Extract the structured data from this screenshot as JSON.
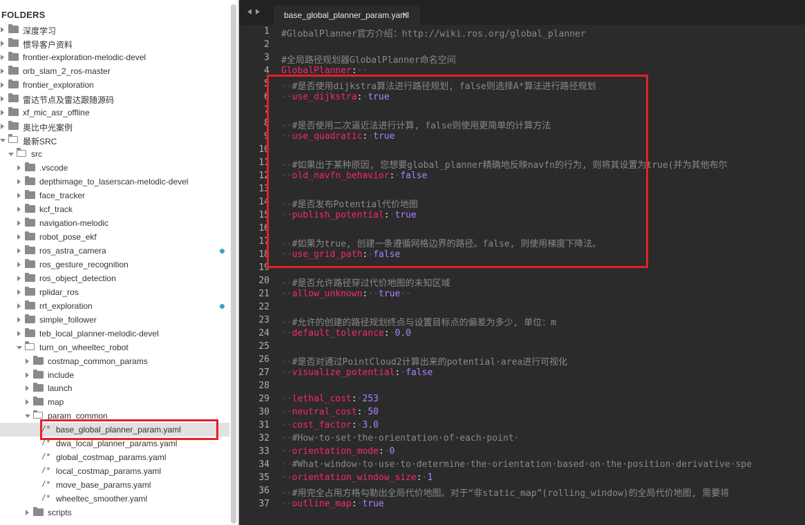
{
  "sidebar": {
    "title": "FOLDERS",
    "items": [
      {
        "label": "深度学习",
        "type": "folder",
        "depth": 0,
        "open": false
      },
      {
        "label": "惯导客户资料",
        "type": "folder",
        "depth": 0,
        "open": false
      },
      {
        "label": "frontier-exploration-melodic-devel",
        "type": "folder",
        "depth": 0,
        "open": false
      },
      {
        "label": "orb_slam_2_ros-master",
        "type": "folder",
        "depth": 0,
        "open": false
      },
      {
        "label": "frontier_exploration",
        "type": "folder",
        "depth": 0,
        "open": false
      },
      {
        "label": "雷达节点及雷达跟随源码",
        "type": "folder",
        "depth": 0,
        "open": false
      },
      {
        "label": "xf_mic_asr_offline",
        "type": "folder",
        "depth": 0,
        "open": false
      },
      {
        "label": "奥比中光案例",
        "type": "folder",
        "depth": 0,
        "open": false
      },
      {
        "label": "最新SRC",
        "type": "folder",
        "depth": 0,
        "open": true
      },
      {
        "label": "src",
        "type": "folder",
        "depth": 1,
        "open": true
      },
      {
        "label": ".vscode",
        "type": "folder",
        "depth": 2,
        "open": false
      },
      {
        "label": "depthimage_to_laserscan-melodic-devel",
        "type": "folder",
        "depth": 2,
        "open": false
      },
      {
        "label": "face_tracker",
        "type": "folder",
        "depth": 2,
        "open": false
      },
      {
        "label": "kcf_track",
        "type": "folder",
        "depth": 2,
        "open": false
      },
      {
        "label": "navigation-melodic",
        "type": "folder",
        "depth": 2,
        "open": false
      },
      {
        "label": "robot_pose_ekf",
        "type": "folder",
        "depth": 2,
        "open": false
      },
      {
        "label": "ros_astra_camera",
        "type": "folder",
        "depth": 2,
        "open": false,
        "dot": true
      },
      {
        "label": "ros_gesture_recognition",
        "type": "folder",
        "depth": 2,
        "open": false
      },
      {
        "label": "ros_object_detection",
        "type": "folder",
        "depth": 2,
        "open": false
      },
      {
        "label": "rplidar_ros",
        "type": "folder",
        "depth": 2,
        "open": false
      },
      {
        "label": "rrt_exploration",
        "type": "folder",
        "depth": 2,
        "open": false,
        "dot": true
      },
      {
        "label": "simple_follower",
        "type": "folder",
        "depth": 2,
        "open": false
      },
      {
        "label": "teb_local_planner-melodic-devel",
        "type": "folder",
        "depth": 2,
        "open": false
      },
      {
        "label": "turn_on_wheeltec_robot",
        "type": "folder",
        "depth": 2,
        "open": true
      },
      {
        "label": "costmap_common_params",
        "type": "folder",
        "depth": 3,
        "open": false
      },
      {
        "label": "include",
        "type": "folder",
        "depth": 3,
        "open": false
      },
      {
        "label": "launch",
        "type": "folder",
        "depth": 3,
        "open": false
      },
      {
        "label": "map",
        "type": "folder",
        "depth": 3,
        "open": false
      },
      {
        "label": "param_common",
        "type": "folder",
        "depth": 3,
        "open": true
      },
      {
        "label": "base_global_planner_param.yaml",
        "type": "file",
        "depth": 4,
        "selected": true
      },
      {
        "label": "dwa_local_planner_params.yaml",
        "type": "file",
        "depth": 4
      },
      {
        "label": "global_costmap_params.yaml",
        "type": "file",
        "depth": 4
      },
      {
        "label": "local_costmap_params.yaml",
        "type": "file",
        "depth": 4
      },
      {
        "label": "move_base_params.yaml",
        "type": "file",
        "depth": 4
      },
      {
        "label": "wheeltec_smoother.yaml",
        "type": "file",
        "depth": 4
      },
      {
        "label": "scripts",
        "type": "folder",
        "depth": 3,
        "open": false
      }
    ],
    "file_glyph": "/*"
  },
  "editor": {
    "tab_label": "base_global_planner_param.yaml",
    "tab_close": "×",
    "whitespace_dot": "·",
    "lines": [
      {
        "n": "1",
        "parts": [
          [
            "c-comment",
            "#GlobalPlanner官方介绍：http://wiki.ros.org/global_planner"
          ]
        ]
      },
      {
        "n": "2",
        "parts": []
      },
      {
        "n": "3",
        "parts": [
          [
            "c-comment",
            "#全局路径规划器GlobalPlanner命名空间"
          ]
        ]
      },
      {
        "n": "4",
        "parts": [
          [
            "c-root",
            "GlobalPlanner"
          ],
          [
            "c-punct",
            ":"
          ],
          [
            "c-ws",
            "··"
          ]
        ]
      },
      {
        "n": "5",
        "parts": [
          [
            "c-ws",
            "··"
          ],
          [
            "c-comment",
            "#是否使用dijkstra算法进行路径规划, false则选择A*算法进行路径规划"
          ]
        ]
      },
      {
        "n": "6",
        "parts": [
          [
            "c-ws",
            "··"
          ],
          [
            "c-key",
            "use_dijkstra"
          ],
          [
            "c-punct",
            ":"
          ],
          [
            "c-ws",
            "·"
          ],
          [
            "c-bool",
            "true"
          ]
        ]
      },
      {
        "n": "7",
        "parts": []
      },
      {
        "n": "8",
        "parts": [
          [
            "c-ws",
            "··"
          ],
          [
            "c-comment",
            "#是否使用二次逼近法进行计算, false则使用更简单的计算方法"
          ]
        ]
      },
      {
        "n": "9",
        "parts": [
          [
            "c-ws",
            "··"
          ],
          [
            "c-key",
            "use_quadratic"
          ],
          [
            "c-punct",
            ":"
          ],
          [
            "c-ws",
            "·"
          ],
          [
            "c-bool",
            "true"
          ]
        ]
      },
      {
        "n": "10",
        "parts": []
      },
      {
        "n": "11",
        "parts": [
          [
            "c-ws",
            "··"
          ],
          [
            "c-comment",
            "#如果出于某种原因, 您想要global_planner精确地反映navfn的行为, 则将其设置为true(并为其他布尔"
          ]
        ]
      },
      {
        "n": "12",
        "parts": [
          [
            "c-ws",
            "··"
          ],
          [
            "c-key",
            "old_navfn_behavior"
          ],
          [
            "c-punct",
            ":"
          ],
          [
            "c-ws",
            "·"
          ],
          [
            "c-bool",
            "false"
          ]
        ]
      },
      {
        "n": "13",
        "parts": []
      },
      {
        "n": "14",
        "parts": [
          [
            "c-ws",
            "··"
          ],
          [
            "c-comment",
            "#是否发布Potential代价地图"
          ]
        ]
      },
      {
        "n": "15",
        "parts": [
          [
            "c-ws",
            "··"
          ],
          [
            "c-key",
            "publish_potential"
          ],
          [
            "c-punct",
            ":"
          ],
          [
            "c-ws",
            "·"
          ],
          [
            "c-bool",
            "true"
          ]
        ]
      },
      {
        "n": "16",
        "parts": []
      },
      {
        "n": "17",
        "parts": [
          [
            "c-ws",
            "··"
          ],
          [
            "c-comment",
            "#如果为true, 创建一条遵循网格边界的路径。false, 则使用梯度下降法。"
          ]
        ]
      },
      {
        "n": "18",
        "parts": [
          [
            "c-ws",
            "··"
          ],
          [
            "c-key",
            "use_grid_path"
          ],
          [
            "c-punct",
            ":"
          ],
          [
            "c-ws",
            "·"
          ],
          [
            "c-bool",
            "false"
          ]
        ]
      },
      {
        "n": "19",
        "parts": []
      },
      {
        "n": "20",
        "parts": [
          [
            "c-ws",
            "··"
          ],
          [
            "c-comment",
            "#是否允许路径穿过代价地图的未知区域"
          ]
        ]
      },
      {
        "n": "21",
        "parts": [
          [
            "c-ws",
            "··"
          ],
          [
            "c-key",
            "allow_unknown"
          ],
          [
            "c-punct",
            ":"
          ],
          [
            "c-ws",
            "··"
          ],
          [
            "c-bool",
            "true"
          ],
          [
            "c-ws",
            "··"
          ]
        ]
      },
      {
        "n": "22",
        "parts": []
      },
      {
        "n": "23",
        "parts": [
          [
            "c-ws",
            "··"
          ],
          [
            "c-comment",
            "#允许的创建的路径规划终点与设置目标点的偏差为多少, 单位：m"
          ]
        ]
      },
      {
        "n": "24",
        "parts": [
          [
            "c-ws",
            "··"
          ],
          [
            "c-key",
            "default_tolerance"
          ],
          [
            "c-punct",
            ":"
          ],
          [
            "c-ws",
            "·"
          ],
          [
            "c-num",
            "0.0"
          ]
        ]
      },
      {
        "n": "25",
        "parts": []
      },
      {
        "n": "26",
        "parts": [
          [
            "c-ws",
            "··"
          ],
          [
            "c-comment",
            "#是否对通过PointCloud2计算出来的potential·area进行可视化"
          ]
        ]
      },
      {
        "n": "27",
        "parts": [
          [
            "c-ws",
            "··"
          ],
          [
            "c-key",
            "visualize_potential"
          ],
          [
            "c-punct",
            ":"
          ],
          [
            "c-ws",
            "·"
          ],
          [
            "c-bool",
            "false"
          ]
        ]
      },
      {
        "n": "28",
        "parts": []
      },
      {
        "n": "29",
        "parts": [
          [
            "c-ws",
            "··"
          ],
          [
            "c-key",
            "lethal_cost"
          ],
          [
            "c-punct",
            ":"
          ],
          [
            "c-ws",
            "·"
          ],
          [
            "c-num",
            "253"
          ]
        ]
      },
      {
        "n": "30",
        "parts": [
          [
            "c-ws",
            "··"
          ],
          [
            "c-key",
            "neutral_cost"
          ],
          [
            "c-punct",
            ":"
          ],
          [
            "c-ws",
            "·"
          ],
          [
            "c-num",
            "50"
          ]
        ]
      },
      {
        "n": "31",
        "parts": [
          [
            "c-ws",
            "··"
          ],
          [
            "c-key",
            "cost_factor"
          ],
          [
            "c-punct",
            ":"
          ],
          [
            "c-ws",
            "·"
          ],
          [
            "c-num",
            "3.0"
          ]
        ]
      },
      {
        "n": "32",
        "parts": [
          [
            "c-ws",
            "··"
          ],
          [
            "c-comment",
            "#How·to·set·the·orientation·of·each·point·"
          ]
        ]
      },
      {
        "n": "33",
        "parts": [
          [
            "c-ws",
            "··"
          ],
          [
            "c-key",
            "orientation_mode"
          ],
          [
            "c-punct",
            ":"
          ],
          [
            "c-ws",
            "·"
          ],
          [
            "c-num",
            "0"
          ]
        ]
      },
      {
        "n": "34",
        "parts": [
          [
            "c-ws",
            "··"
          ],
          [
            "c-comment",
            "#What·window·to·use·to·determine·the·orientation·based·on·the·position·derivative·spe"
          ]
        ]
      },
      {
        "n": "35",
        "parts": [
          [
            "c-ws",
            "··"
          ],
          [
            "c-key",
            "orientation_window_size"
          ],
          [
            "c-punct",
            ":"
          ],
          [
            "c-ws",
            "·"
          ],
          [
            "c-num",
            "1"
          ]
        ]
      },
      {
        "n": "36",
        "parts": [
          [
            "c-ws",
            "··"
          ],
          [
            "c-comment",
            "#用完全占用方格勾勒出全局代价地图。对于“非static_map”(rolling_window)的全局代价地图, 需要将"
          ]
        ]
      },
      {
        "n": "37",
        "parts": [
          [
            "c-ws",
            "··"
          ],
          [
            "c-key",
            "outline_map"
          ],
          [
            "c-punct",
            ":"
          ],
          [
            "c-ws",
            "·"
          ],
          [
            "c-bool",
            "true"
          ]
        ]
      }
    ]
  }
}
